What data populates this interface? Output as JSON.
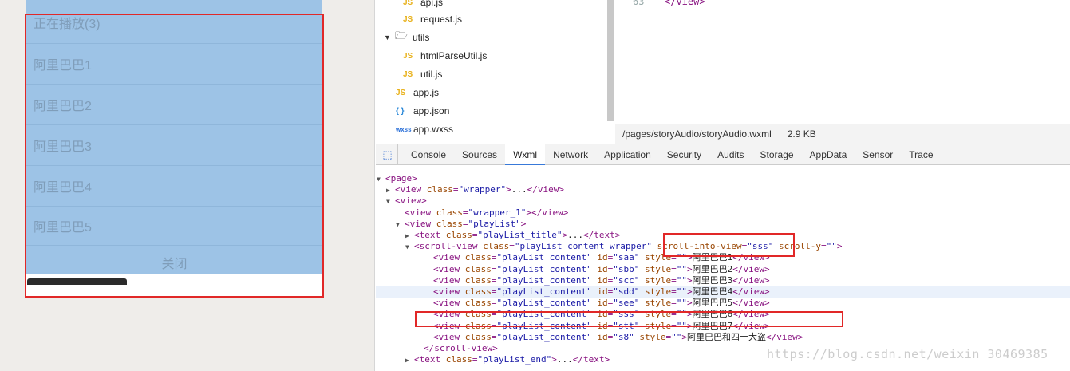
{
  "simulator": {
    "playlist_title": "正在播放(3)",
    "items": [
      "阿里巴巴1",
      "阿里巴巴2",
      "阿里巴巴3",
      "阿里巴巴4",
      "阿里巴巴5"
    ],
    "close_label": "关闭"
  },
  "file_tree": {
    "items": [
      {
        "icon": "JS",
        "name": "api.js"
      },
      {
        "icon": "JS",
        "name": "request.js"
      },
      {
        "icon": "folder",
        "name": "utils"
      },
      {
        "icon": "JS",
        "name": "htmlParseUtil.js"
      },
      {
        "icon": "JS",
        "name": "util.js"
      },
      {
        "icon": "JS",
        "name": "app.js"
      },
      {
        "icon": "{ }",
        "name": "app.json"
      },
      {
        "icon": "wxss",
        "name": "app.wxss"
      }
    ]
  },
  "code": {
    "line_number": "63",
    "text": "</view>"
  },
  "status_bar": {
    "path": "/pages/storyAudio/storyAudio.wxml",
    "size": "2.9 KB"
  },
  "devtools": {
    "tabs": [
      "Console",
      "Sources",
      "Wxml",
      "Network",
      "Application",
      "Security",
      "Audits",
      "Storage",
      "AppData",
      "Sensor",
      "Trace"
    ],
    "active_tab": "Wxml",
    "wxml_rows": [
      {
        "t": "<page>"
      },
      {
        "t": "<view class=\"wrapper\">...</view>"
      },
      {
        "t": "<view>"
      },
      {
        "t": "<view class=\"wrapper_1\"></view>"
      },
      {
        "t": "<view class=\"playList\">"
      },
      {
        "t": "<text class=\"playList_title\">...</text>"
      },
      {
        "t": "<scroll-view class=\"playList_content_wrapper\" scroll-into-view=\"sss\" scroll-y=\"\">"
      },
      {
        "t": "<view class=\"playList_content\" id=\"saa\" style=\"\">阿里巴巴1</view>"
      },
      {
        "t": "<view class=\"playList_content\" id=\"sbb\" style=\"\">阿里巴巴2</view>"
      },
      {
        "t": "<view class=\"playList_content\" id=\"scc\" style=\"\">阿里巴巴3</view>"
      },
      {
        "t": "<view class=\"playList_content\" id=\"sdd\" style=\"\">阿里巴巴4</view>"
      },
      {
        "t": "<view class=\"playList_content\" id=\"see\" style=\"\">阿里巴巴5</view>"
      },
      {
        "t": "<view class=\"playList_content\" id=\"sss\" style=\"\">阿里巴巴6</view>"
      },
      {
        "t": "<view class=\"playList_content\" id=\"stt\" style=\"\">阿里巴巴7</view>"
      },
      {
        "t": "<view class=\"playList_content\" id=\"s8\" style=\"\">阿里巴巴和四十大盗</view>"
      },
      {
        "t": "</scroll-view>"
      },
      {
        "t": "<text class=\"playList_end\">...</text>"
      }
    ]
  },
  "watermark": "https://blog.csdn.net/weixin_30469385",
  "colors": {
    "highlight_box": "#e12828",
    "panel": "#9dc3e6",
    "active_tab": "#3879d9"
  }
}
